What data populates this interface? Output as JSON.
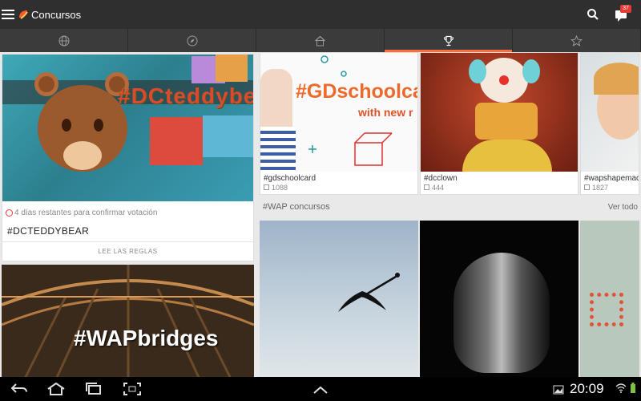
{
  "app": {
    "title": "Concursos",
    "notification_count": "37",
    "accent_color": "#ff6d3b"
  },
  "tabs": [
    {
      "name": "globe-icon"
    },
    {
      "name": "compass-icon"
    },
    {
      "name": "home-icon"
    },
    {
      "name": "trophy-icon",
      "active": true
    },
    {
      "name": "star-icon"
    }
  ],
  "featured": {
    "hero_hashtag": "#DCteddybear",
    "days_left": "4 días restantes para confirmar votación",
    "name": "#DCTEDDYBEAR",
    "rules_button": "LEE LAS REGLAS",
    "next_hashtag": "#WAPbridges"
  },
  "contests": [
    {
      "label": "#gdschoolcard",
      "count": "1088",
      "overlay": "#GDschoolca",
      "subtext": "with new r"
    },
    {
      "label": "#dcclown",
      "count": "444"
    },
    {
      "label": "#wapshapemac",
      "count": "1827"
    }
  ],
  "wap_section": {
    "title": "#WAP concursos",
    "see_all": "Ver todo"
  },
  "system_bar": {
    "time": "20:09"
  }
}
